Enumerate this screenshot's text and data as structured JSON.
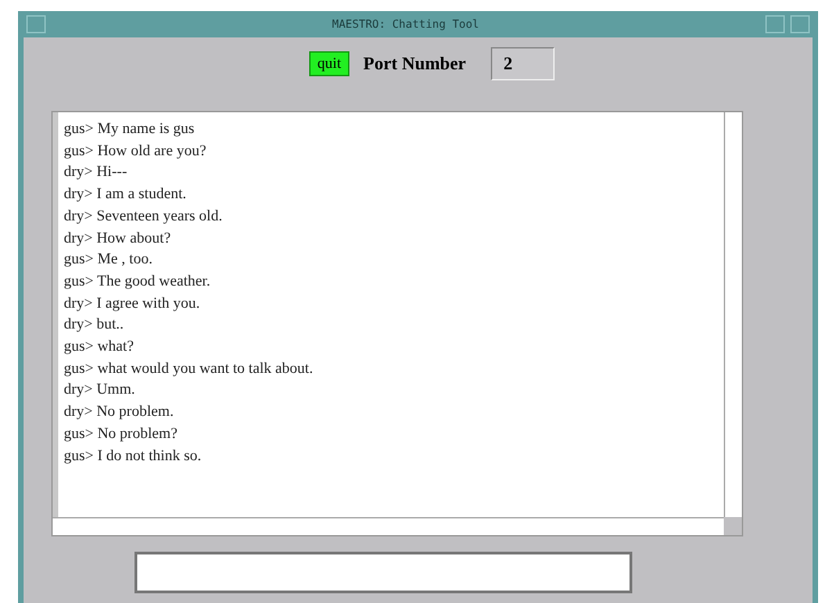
{
  "window": {
    "title": "MAESTRO: Chatting Tool"
  },
  "toolbar": {
    "quit_button": "quit",
    "port_label": "Port Number",
    "port_value": "2"
  },
  "messages": [
    {
      "text": "gus> My name is gus"
    },
    {
      "text": "gus> How old are you?"
    },
    {
      "text": "dry> Hi---"
    },
    {
      "text": "dry> I am a student."
    },
    {
      "text": "dry> Seventeen years old."
    },
    {
      "text": "dry> How about?"
    },
    {
      "text": "gus> Me , too."
    },
    {
      "text": "gus> The good weather."
    },
    {
      "text": "dry> I agree with you."
    },
    {
      "text": "dry> but.."
    },
    {
      "text": "gus> what?"
    },
    {
      "text": "gus> what would you want to talk about."
    },
    {
      "text": "dry> Umm."
    },
    {
      "text": "dry> No problem."
    },
    {
      "text": "gus> No problem?"
    },
    {
      "text": "gus> I do not think so."
    }
  ]
}
